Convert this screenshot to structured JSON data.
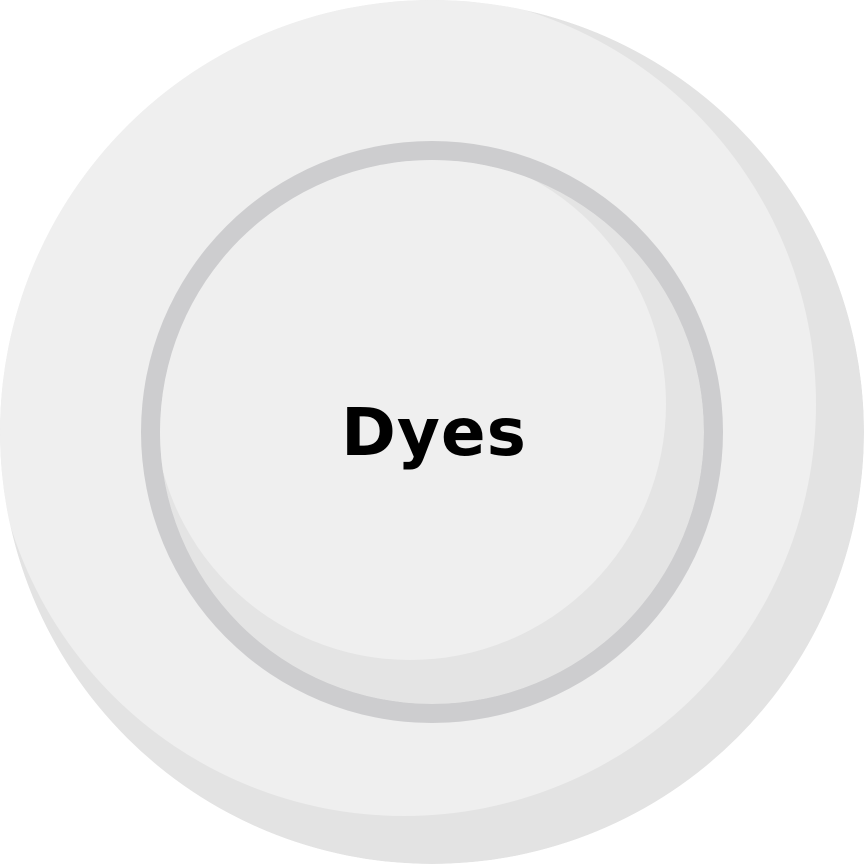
{
  "plate": {
    "label": "Dyes",
    "colors": {
      "outer_face": "#efefef",
      "outer_shadow": "#e3e3e3",
      "inner_ring": "#cdcdcf",
      "inner_face": "#efefef",
      "inner_shadow": "#e4e4e4",
      "text": "#000000"
    }
  }
}
